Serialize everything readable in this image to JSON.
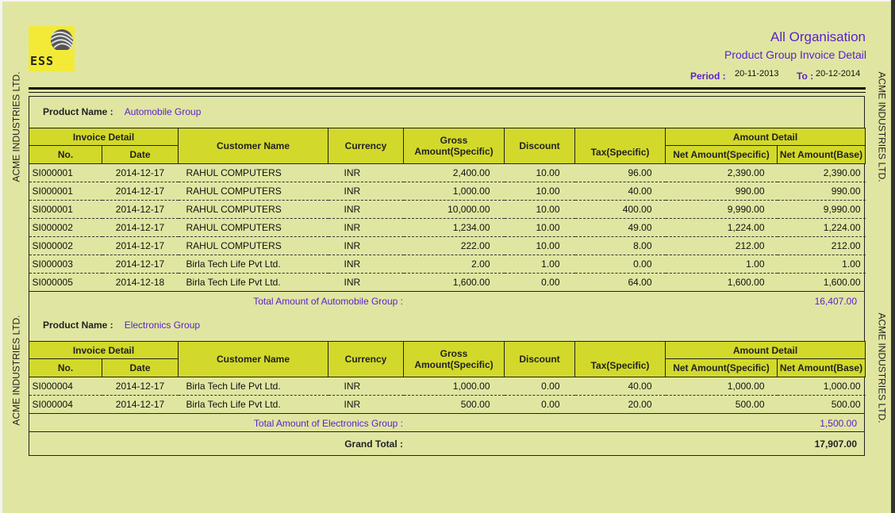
{
  "header": {
    "logo_text": "ESS",
    "org_title": "All Organisation",
    "report_title": "Product Group Invoice Detail",
    "period_label": "Period :",
    "period_from": "20-11-2013",
    "to_label": "To :",
    "period_to": "20-12-2014",
    "side_text": "ACME INDUSTRIES LTD."
  },
  "columns": {
    "invoice_detail": "Invoice Detail",
    "no": "No.",
    "date": "Date",
    "customer_name": "Customer Name",
    "currency": "Currency",
    "gross_amount": "Gross Amount(Specific)",
    "discount": "Discount",
    "tax": "Tax(Specific)",
    "amount_detail": "Amount Detail",
    "net_specific": "Net Amount(Specific)",
    "net_base": "Net Amount(Base)"
  },
  "product_label": "Product Name  :",
  "groups": [
    {
      "name": "Automobile Group",
      "rows": [
        {
          "no": "SI000001",
          "date": "2014-12-17",
          "customer": "RAHUL COMPUTERS",
          "currency": "INR",
          "gross": "2,400.00",
          "discount": "10.00",
          "tax": "96.00",
          "net_specific": "2,390.00",
          "net_base": "2,390.00"
        },
        {
          "no": "SI000001",
          "date": "2014-12-17",
          "customer": "RAHUL COMPUTERS",
          "currency": "INR",
          "gross": "1,000.00",
          "discount": "10.00",
          "tax": "40.00",
          "net_specific": "990.00",
          "net_base": "990.00"
        },
        {
          "no": "SI000001",
          "date": "2014-12-17",
          "customer": "RAHUL COMPUTERS",
          "currency": "INR",
          "gross": "10,000.00",
          "discount": "10.00",
          "tax": "400.00",
          "net_specific": "9,990.00",
          "net_base": "9,990.00"
        },
        {
          "no": "SI000002",
          "date": "2014-12-17",
          "customer": "RAHUL COMPUTERS",
          "currency": "INR",
          "gross": "1,234.00",
          "discount": "10.00",
          "tax": "49.00",
          "net_specific": "1,224.00",
          "net_base": "1,224.00"
        },
        {
          "no": "SI000002",
          "date": "2014-12-17",
          "customer": "RAHUL COMPUTERS",
          "currency": "INR",
          "gross": "222.00",
          "discount": "10.00",
          "tax": "8.00",
          "net_specific": "212.00",
          "net_base": "212.00"
        },
        {
          "no": "SI000003",
          "date": "2014-12-17",
          "customer": "Birla Tech Life Pvt Ltd.",
          "currency": "INR",
          "gross": "2.00",
          "discount": "1.00",
          "tax": "0.00",
          "net_specific": "1.00",
          "net_base": "1.00"
        },
        {
          "no": "SI000005",
          "date": "2014-12-18",
          "customer": "Birla Tech Life Pvt Ltd.",
          "currency": "INR",
          "gross": "1,600.00",
          "discount": "0.00",
          "tax": "64.00",
          "net_specific": "1,600.00",
          "net_base": "1,600.00"
        }
      ],
      "total_label": "Total Amount of Automobile Group :",
      "total_value": "16,407.00"
    },
    {
      "name": "Electronics Group",
      "rows": [
        {
          "no": "SI000004",
          "date": "2014-12-17",
          "customer": "Birla Tech Life Pvt Ltd.",
          "currency": "INR",
          "gross": "1,000.00",
          "discount": "0.00",
          "tax": "40.00",
          "net_specific": "1,000.00",
          "net_base": "1,000.00"
        },
        {
          "no": "SI000004",
          "date": "2014-12-17",
          "customer": "Birla Tech Life Pvt Ltd.",
          "currency": "INR",
          "gross": "500.00",
          "discount": "0.00",
          "tax": "20.00",
          "net_specific": "500.00",
          "net_base": "500.00"
        }
      ],
      "total_label": "Total Amount of Electronics Group :",
      "total_value": "1,500.00"
    }
  ],
  "grand_total_label": "Grand Total :",
  "grand_total_value": "17,907.00"
}
